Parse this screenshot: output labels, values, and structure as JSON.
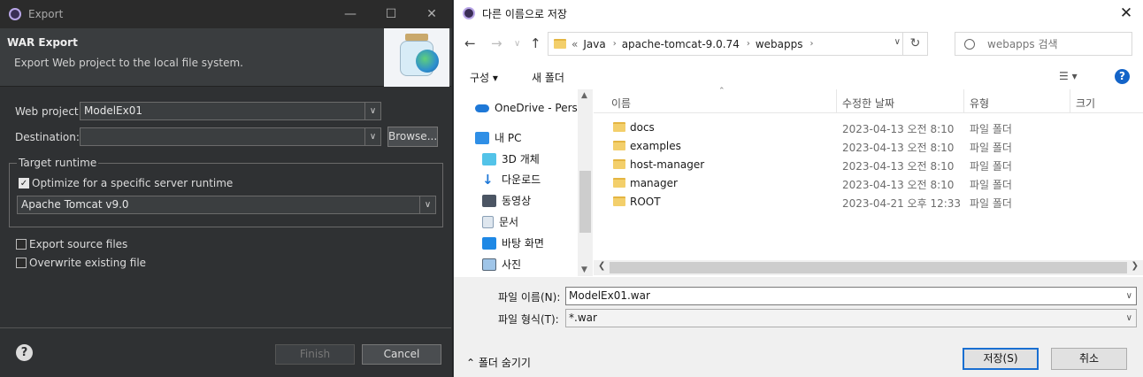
{
  "eclipse": {
    "window_title": "Export",
    "header_title": "WAR Export",
    "header_subtitle": "Export Web project to the local file system.",
    "web_project_label": "Web project:",
    "web_project_value": "ModelEx01",
    "destination_label": "Destination:",
    "destination_value": "",
    "browse_label": "Browse...",
    "target_runtime_label": "Target runtime",
    "optimize_label": "Optimize for a specific server runtime",
    "optimize_checked": true,
    "runtime_value": "Apache Tomcat v9.0",
    "export_source_label": "Export source files",
    "overwrite_label": "Overwrite existing file",
    "finish_label": "Finish",
    "cancel_label": "Cancel"
  },
  "save_dialog": {
    "title": "다른 이름으로 저장",
    "breadcrumb": [
      "Java",
      "apache-tomcat-9.0.74",
      "webapps"
    ],
    "search_placeholder": "webapps 검색",
    "organize_label": "구성 ▾",
    "new_folder_label": "새 폴더",
    "nav_items": [
      "OneDrive - Persor",
      "내 PC",
      "3D 개체",
      "다운로드",
      "동영상",
      "문서",
      "바탕 화면",
      "사진"
    ],
    "columns": [
      "이름",
      "수정한 날짜",
      "유형",
      "크기"
    ],
    "files": [
      {
        "name": "docs",
        "date": "2023-04-13 오전 8:10",
        "type": "파일 폴더"
      },
      {
        "name": "examples",
        "date": "2023-04-13 오전 8:10",
        "type": "파일 폴더"
      },
      {
        "name": "host-manager",
        "date": "2023-04-13 오전 8:10",
        "type": "파일 폴더"
      },
      {
        "name": "manager",
        "date": "2023-04-13 오전 8:10",
        "type": "파일 폴더"
      },
      {
        "name": "ROOT",
        "date": "2023-04-21 오후 12:33",
        "type": "파일 폴더"
      }
    ],
    "filename_label": "파일 이름(N):",
    "filename_value": "ModelEx01.war",
    "filetype_label": "파일 형식(T):",
    "filetype_value": "*.war",
    "hide_folders_label": "폴더 숨기기",
    "save_label": "저장(S)",
    "cancel_label": "취소"
  }
}
